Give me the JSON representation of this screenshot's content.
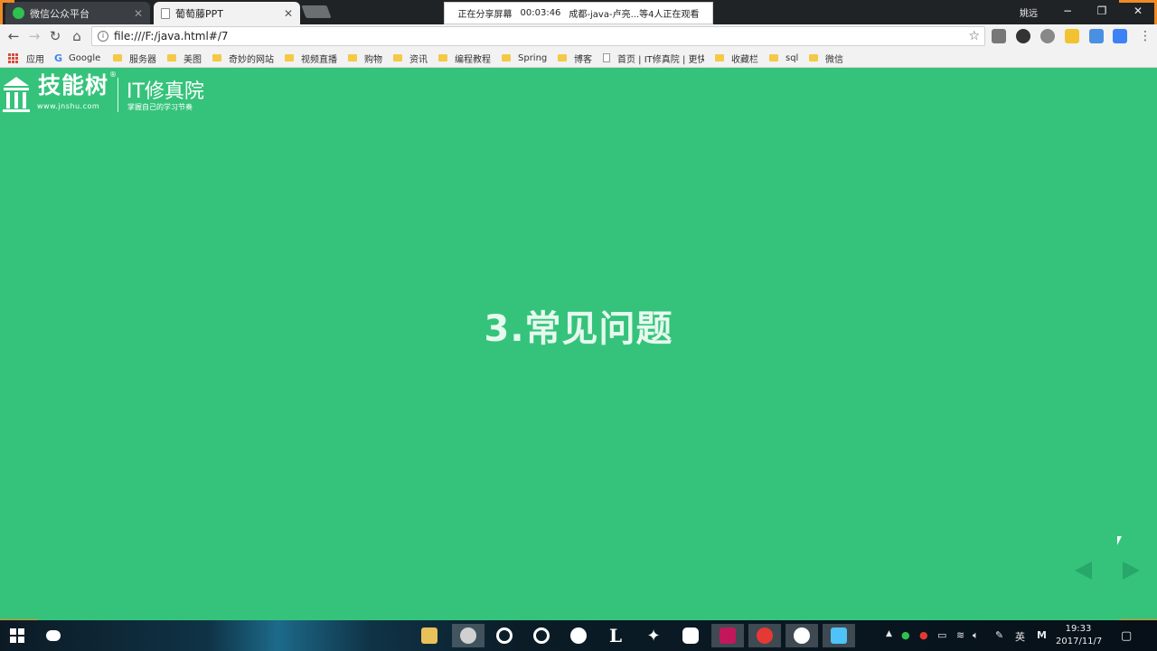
{
  "tabs": [
    {
      "title": "微信公众平台",
      "icon_color": "#2dc24f"
    },
    {
      "title": "葡萄藤PPT",
      "icon_color": "#ffffff"
    }
  ],
  "screen_share": {
    "status": "正在分享屏幕",
    "time": "00:03:46",
    "viewers": "成都-java-卢亮...等4人正在观看"
  },
  "user_name": "姚远",
  "window_controls": {
    "minimize": "−",
    "restore": "❐",
    "close": "✕"
  },
  "address_bar": {
    "url": "file:///F:/java.html#/7"
  },
  "extensions": [
    {
      "name": "es-extension",
      "color": "#777"
    },
    {
      "name": "circle-extension",
      "color": "#333"
    },
    {
      "name": "wordpress-extension",
      "color": "#888"
    },
    {
      "name": "notes-extension",
      "color": "#f1c232"
    },
    {
      "name": "off-extension",
      "color": "#4a90e2"
    },
    {
      "name": "blue-extension",
      "color": "#3b82f6"
    }
  ],
  "bookmarks": [
    {
      "label": "应用",
      "type": "apps"
    },
    {
      "label": "Google",
      "type": "google"
    },
    {
      "label": "服务器",
      "type": "folder"
    },
    {
      "label": "美图",
      "type": "folder"
    },
    {
      "label": "奇妙的网站",
      "type": "folder"
    },
    {
      "label": "视频直播",
      "type": "folder"
    },
    {
      "label": "购物",
      "type": "folder"
    },
    {
      "label": "资讯",
      "type": "folder"
    },
    {
      "label": "编程教程",
      "type": "folder"
    },
    {
      "label": "Spring",
      "type": "folder"
    },
    {
      "label": "博客",
      "type": "folder"
    },
    {
      "label": "首页 | IT修真院 | 更快",
      "type": "page"
    },
    {
      "label": "收藏栏",
      "type": "folder"
    },
    {
      "label": "sql",
      "type": "folder"
    },
    {
      "label": "微信",
      "type": "folder"
    }
  ],
  "slide": {
    "logo_brand": "技能树",
    "logo_site": "www.jnshu.com",
    "logo_it": "IT修真院",
    "logo_slogan": "掌握自己的学习节奏",
    "logo_reg": "®",
    "heading": "3.常见问题"
  },
  "taskbar_apps": [
    {
      "name": "file-explorer-app",
      "color": "#e8c15a"
    },
    {
      "name": "settings-app",
      "color": "#c8c8c8",
      "active": true
    },
    {
      "name": "chrome-app",
      "color": "#ffffff"
    },
    {
      "name": "netease-music-app",
      "color": "#ffffff"
    },
    {
      "name": "steam-app",
      "color": "#ffffff"
    },
    {
      "name": "l-app",
      "color": "#ffffff"
    },
    {
      "name": "vscode-app",
      "color": "#ffffff"
    },
    {
      "name": "sublime-app",
      "color": "#ffffff"
    },
    {
      "name": "intellij-app",
      "color": "#c2185b",
      "active": true
    },
    {
      "name": "snail-app",
      "color": "#e53935",
      "active": true
    },
    {
      "name": "gear-app",
      "color": "#ffffff",
      "active": true
    },
    {
      "name": "screen-app",
      "color": "#4fc3f7",
      "active": true
    }
  ],
  "tray": {
    "lang": "英",
    "ime": "M",
    "time": "19:33",
    "date": "2017/11/7"
  }
}
